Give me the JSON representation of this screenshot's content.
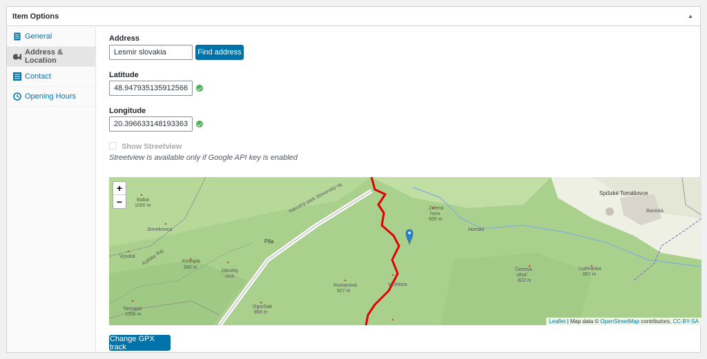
{
  "panel": {
    "title": "Item Options"
  },
  "sidebar": {
    "items": [
      {
        "label": "General"
      },
      {
        "label": "Address & Location"
      },
      {
        "label": "Contact"
      },
      {
        "label": "Opening Hours"
      }
    ]
  },
  "address": {
    "label": "Address",
    "value": "Lesmir slovakia",
    "find_label": "Find address"
  },
  "latitude": {
    "label": "Latitude",
    "value": "48.947935135912566"
  },
  "longitude": {
    "label": "Longitude",
    "value": "20.396633148193363"
  },
  "streetview": {
    "label": "Show Streetview",
    "hint": "Streetview is available only if Google API key is enabled",
    "checked": false
  },
  "map": {
    "zoom_in": "+",
    "zoom_out": "−",
    "places": [
      {
        "name": "Spišské Tomášovce"
      },
      {
        "name": "Baniská"
      },
      {
        "name": "Pila"
      },
      {
        "name": "Babia",
        "elev": "1000 m"
      },
      {
        "name": "Smrekovica"
      },
      {
        "name": "Vysoká"
      },
      {
        "name": "Krompla",
        "elev": "990 m"
      },
      {
        "name": "Okrúhly",
        "elev": "vrch"
      },
      {
        "name": "Rumanová",
        "elev": "927 m"
      },
      {
        "name": "Vichhora"
      },
      {
        "name": "Ogurčiak",
        "elev": "869 m"
      },
      {
        "name": "Tarnopol",
        "elev": "1056 m"
      },
      {
        "name": "Zelená",
        "elev": "hora"
      },
      {
        "name": "655 m"
      },
      {
        "name": "Čertova",
        "elev": "sihoť"
      },
      {
        "name": "822 m"
      },
      {
        "name": "Ľudmanka",
        "elev": "667 m"
      },
      {
        "name": "Hornád"
      },
      {
        "name": "Národný park Slovenský raj"
      },
      {
        "name": "Kolísky Raj"
      }
    ],
    "attribution": {
      "leaflet": "Leaflet",
      "sep": " | Map data © ",
      "osm": "OpenStreetMap",
      "contrib": " contributors, ",
      "license": "CC-BY-SA"
    }
  },
  "gpx": {
    "label": "Change GPX track"
  },
  "colors": {
    "accent": "#0073aa",
    "success": "#46b450",
    "track": "#e00000",
    "marker": "#2a81cb"
  }
}
